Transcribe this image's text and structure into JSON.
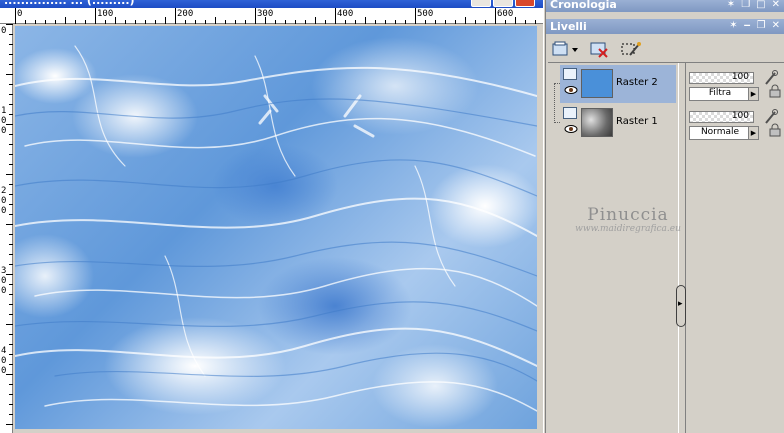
{
  "document_window": {
    "title": "...............  ...  (.........)",
    "ruler_h_ticks": [
      "0",
      "100",
      "200",
      "300",
      "400",
      "500",
      "600"
    ],
    "ruler_v_ticks": [
      {
        "l1": "0"
      },
      {
        "l1": "1",
        "l2": "0",
        "l3": "0"
      },
      {
        "l1": "2",
        "l2": "0",
        "l3": "0"
      },
      {
        "l1": "3",
        "l2": "0",
        "l3": "0"
      },
      {
        "l1": "4",
        "l2": "0",
        "l3": "0"
      }
    ]
  },
  "panels": {
    "cronologia": {
      "title": "Cronologia"
    },
    "livelli": {
      "title": "Livelli"
    }
  },
  "layers": [
    {
      "name": "Raster 2",
      "opacity": 100,
      "blend_mode": "Filtra",
      "selected": true,
      "thumb_color": "#4a90d9"
    },
    {
      "name": "Raster 1",
      "opacity": 100,
      "blend_mode": "Normale",
      "selected": false,
      "thumb_color": "#8a8a8a"
    }
  ],
  "watermark": {
    "name": "Pinuccia",
    "url": "www.maidiregrafica.eu"
  },
  "colors": {
    "panel_title": "#8ca4cc",
    "selection": "#9cb4d8",
    "window_title": "#2858d0"
  }
}
